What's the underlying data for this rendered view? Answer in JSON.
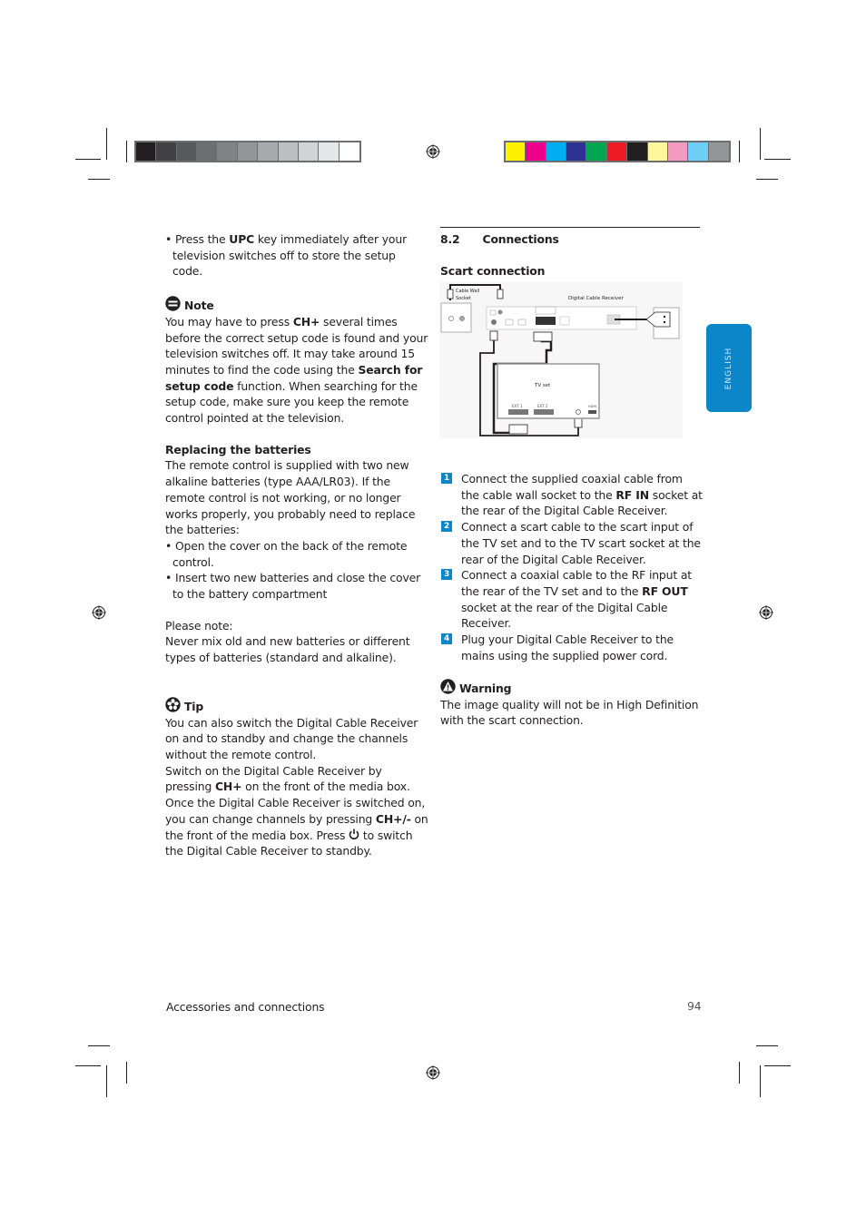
{
  "registration": {
    "gray_swatches": [
      "#231f20",
      "#414042",
      "#58595b",
      "#6d6e71",
      "#808285",
      "#939598",
      "#a7a9ac",
      "#bcbec0",
      "#d1d3d4",
      "#e6e7e8",
      "#ffffff"
    ],
    "color_swatches": [
      "#fff200",
      "#ec008c",
      "#00aeef",
      "#2e3192",
      "#00a651",
      "#ed1c24",
      "#231f20",
      "#fff799",
      "#f49ac1",
      "#6dcff6",
      "#939598"
    ]
  },
  "left": {
    "bullet_upc": {
      "pre": "• Press the ",
      "bold": "UPC",
      "post": " key immediately after your television switches off to store the setup code."
    },
    "note": {
      "icon": "note-icon",
      "title": "Note",
      "p1": "You may have to press ",
      "b1": "CH+",
      "p2": " several times before the correct setup code is found and your television switches off. It may take around 15 minutes to find the code using the ",
      "b2": "Search for setup code",
      "p3": " function. When searching for the setup code, make sure you keep the remote control pointed at the television."
    },
    "batteries": {
      "title": "Replacing the batteries",
      "body": "The remote control is supplied with two new alkaline batteries (type AAA/LR03). If the remote control is not working, or no longer works properly, you probably need to replace the batteries:",
      "bullets": [
        "• Open the cover on the back of the remote control.",
        "• Insert two new batteries and close the cover to the battery compartment"
      ],
      "please_note": "Please note:",
      "never_mix": "Never mix old and new batteries or different types of batteries (standard and alkaline)."
    },
    "tip": {
      "icon": "tip-icon",
      "title": "Tip",
      "p1": "You can also switch the Digital Cable Receiver on and to standby and change the channels without the remote control.",
      "p2a": "Switch on the Digital Cable Receiver by pressing ",
      "p2b": "CH+",
      "p2c": " on the front of the media box.",
      "p3a": "Once the Digital Cable Receiver is switched on, you can change channels by pressing ",
      "p3b": "CH+/-",
      "p3c": " on the front of the media box. Press ",
      "power_icon": "power-icon",
      "p3d": " to switch the Digital Cable Receiver to standby."
    }
  },
  "right": {
    "section_number": "8.2",
    "section_title": "Connections",
    "subsection": "Scart connection",
    "diagram": {
      "wall_socket_label_1": "Cable Wall",
      "wall_socket_label_2": "Socket",
      "receiver_label": "Digital Cable Receiver",
      "tv_label": "TV set",
      "ext1": "EXT 1",
      "ext2": "EXT 2",
      "hdmi": "HDMI"
    },
    "steps": [
      {
        "num": "1",
        "pre": "Connect the supplied coaxial cable from the cable wall socket to the ",
        "bold": "RF IN",
        "post": " socket at the rear of the Digital Cable Receiver."
      },
      {
        "num": "2",
        "pre": "Connect a scart cable to the scart input of the TV set and to the TV scart socket at the rear of the Digital Cable Receiver.",
        "bold": "",
        "post": ""
      },
      {
        "num": "3",
        "pre": "Connect a coaxial cable to the RF input at the rear of the TV set and to the ",
        "bold": "RF OUT",
        "post": " socket at the rear of the Digital Cable Receiver."
      },
      {
        "num": "4",
        "pre": "Plug your Digital Cable Receiver to the mains using the supplied power cord.",
        "bold": "",
        "post": ""
      }
    ],
    "warning": {
      "icon": "warning-icon",
      "title": "Warning",
      "body": "The image quality will not be in High Definition with the scart connection."
    }
  },
  "language_tab": "ENGLISH",
  "footer": {
    "section": "Accessories and connections",
    "page_number": "94"
  }
}
